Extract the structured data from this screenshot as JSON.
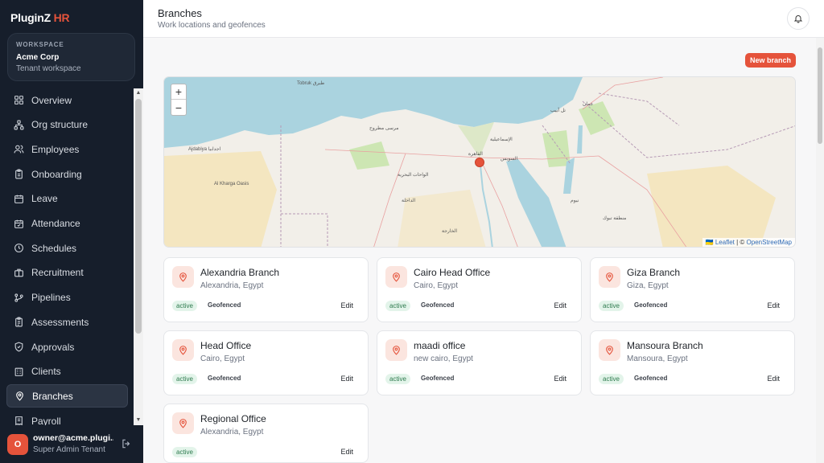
{
  "brand": {
    "name": "PluginZ",
    "accent": "HR"
  },
  "workspace": {
    "label": "WORKSPACE",
    "name": "Acme Corp",
    "subtitle": "Tenant workspace"
  },
  "nav": [
    {
      "label": "Overview",
      "icon": "grid-icon",
      "active": false
    },
    {
      "label": "Org structure",
      "icon": "hierarchy-icon",
      "active": false
    },
    {
      "label": "Employees",
      "icon": "users-icon",
      "active": false
    },
    {
      "label": "Onboarding",
      "icon": "clipboard-icon",
      "active": false
    },
    {
      "label": "Leave",
      "icon": "calendar-icon",
      "active": false
    },
    {
      "label": "Attendance",
      "icon": "calendar-check-icon",
      "active": false
    },
    {
      "label": "Schedules",
      "icon": "clock-icon",
      "active": false
    },
    {
      "label": "Recruitment",
      "icon": "briefcase-icon",
      "active": false
    },
    {
      "label": "Pipelines",
      "icon": "git-branch-icon",
      "active": false
    },
    {
      "label": "Assessments",
      "icon": "clipboard-list-icon",
      "active": false
    },
    {
      "label": "Approvals",
      "icon": "shield-check-icon",
      "active": false
    },
    {
      "label": "Clients",
      "icon": "building-icon",
      "active": false
    },
    {
      "label": "Branches",
      "icon": "map-pin-icon",
      "active": true
    },
    {
      "label": "Payroll",
      "icon": "receipt-icon",
      "active": false
    }
  ],
  "user": {
    "initial": "O",
    "email": "owner@acme.plugi...",
    "role": "Super Admin Tenant"
  },
  "header": {
    "title": "Branches",
    "subtitle": "Work locations and geofences"
  },
  "actions": {
    "new_branch": "New branch"
  },
  "map": {
    "zoom_in": "+",
    "zoom_out": "−",
    "attribution_leaflet": "Leaflet",
    "attribution_sep": " | © ",
    "attribution_osm": "OpenStreetMap",
    "labels": [
      "Tobruk طبرق",
      "Ajdabiya اجدابيا",
      "القاهرة",
      "الإسماعيلية",
      "السويس",
      "مرسى مطروح",
      "الواحات البحرية",
      "تل أبيب",
      "عمان",
      "نيوم",
      "منطقة تبوك",
      "الداخلة",
      "الخارجة",
      "Al Kharga Oasis"
    ]
  },
  "branches": [
    {
      "name": "Alexandria Branch",
      "location": "Alexandria, Egypt",
      "status": "active",
      "geofence": "Geofenced",
      "edit": "Edit"
    },
    {
      "name": "Cairo Head Office",
      "location": "Cairo, Egypt",
      "status": "active",
      "geofence": "Geofenced",
      "edit": "Edit"
    },
    {
      "name": "Giza Branch",
      "location": "Giza, Egypt",
      "status": "active",
      "geofence": "Geofenced",
      "edit": "Edit"
    },
    {
      "name": "Head Office",
      "location": "Cairo, Egypt",
      "status": "active",
      "geofence": "Geofenced",
      "edit": "Edit"
    },
    {
      "name": "maadi office",
      "location": "new cairo, Egypt",
      "status": "active",
      "geofence": "Geofenced",
      "edit": "Edit"
    },
    {
      "name": "Mansoura Branch",
      "location": "Mansoura, Egypt",
      "status": "active",
      "geofence": "Geofenced",
      "edit": "Edit"
    },
    {
      "name": "Regional Office",
      "location": "Alexandria, Egypt",
      "status": "active",
      "geofence": "",
      "edit": "Edit"
    }
  ],
  "colors": {
    "accent": "#e5533b",
    "sidebar_bg": "#161e2b",
    "sea": "#aad3df",
    "land": "#f2efe9",
    "desert": "#f4e3b5"
  }
}
